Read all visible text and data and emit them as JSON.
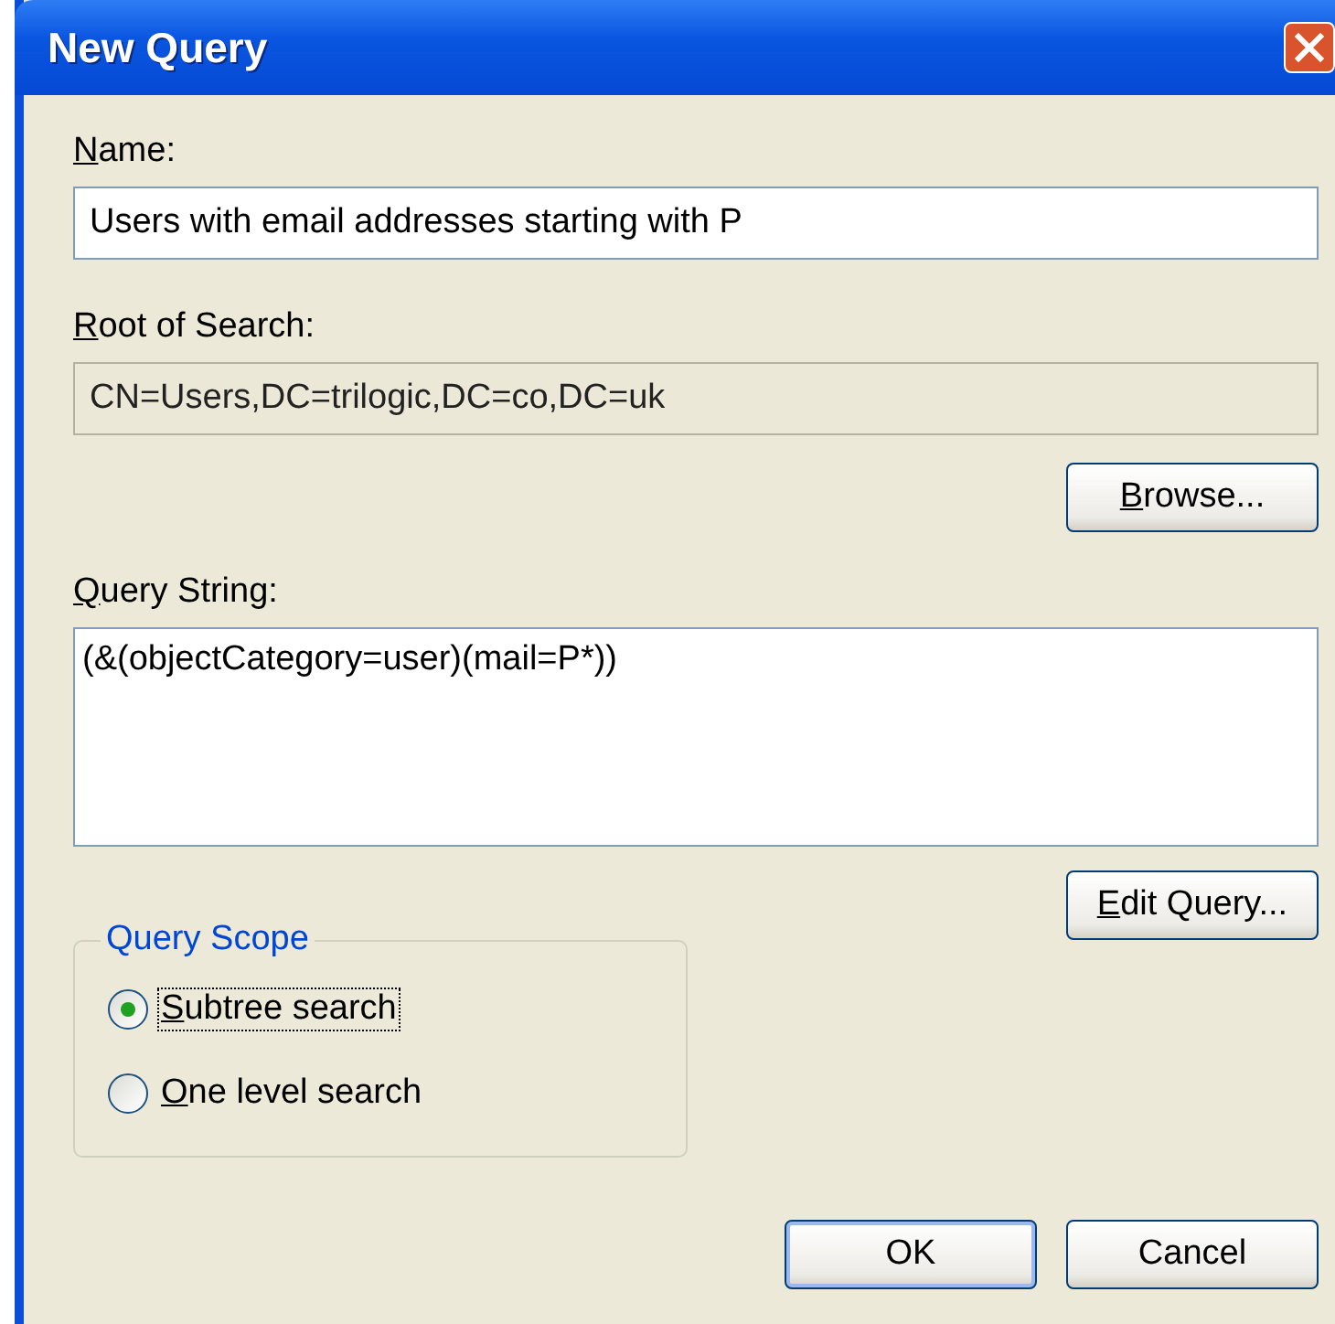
{
  "window": {
    "title": "New Query"
  },
  "name": {
    "access_key": "N",
    "label_rest": "ame:",
    "value": "Users with email addresses starting with P"
  },
  "root_of_search": {
    "access_key": "R",
    "label_rest": "oot of Search:",
    "value": "CN=Users,DC=trilogic,DC=co,DC=uk",
    "disabled": true
  },
  "browse_button": {
    "access_key": "B",
    "label_rest": "rowse..."
  },
  "query_string": {
    "access_key": "Q",
    "label_rest": "uery String:",
    "value": "(&(objectCategory=user)(mail=P*))"
  },
  "edit_query_button": {
    "access_key": "E",
    "label_rest": "dit Query..."
  },
  "query_scope": {
    "title": "Query Scope",
    "options": [
      {
        "access_key": "S",
        "label_rest": "ubtree search",
        "selected": true,
        "focused": true
      },
      {
        "access_key": "O",
        "label_rest": "ne level search",
        "selected": false,
        "focused": false
      }
    ]
  },
  "buttons": [
    {
      "label": "OK",
      "default": true
    },
    {
      "label": "Cancel",
      "default": false
    }
  ]
}
